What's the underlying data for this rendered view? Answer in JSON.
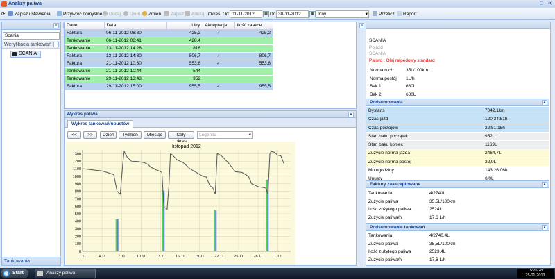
{
  "app": {
    "title": "Analizy paliwa",
    "maximize": "□",
    "close": "✕"
  },
  "toolbar": {
    "save_layout": "Zapisz ustawienia",
    "restore_default": "Przywróć domyślne",
    "add": "Dodaj",
    "delete": "Usuń",
    "edit": "Zmień",
    "save": "Zapisz",
    "cancel": "Anuluj",
    "period_label": "Okres",
    "from_label": "Od",
    "from_value": "01-11-2012",
    "to_label": "Do",
    "to_value": "30-11-2012",
    "period_select": "Inny",
    "recalc": "Przelicz",
    "report": "Raport"
  },
  "left": {
    "collapse": "«",
    "search_value": "Scania",
    "section": "Weryfikacja tankowań",
    "tree_item": "SCANIA",
    "bottom_tab": "Tankowania",
    "expand": "»"
  },
  "grid": {
    "headers": [
      "Dane",
      "Data",
      "Litry",
      "Akceptacja",
      "Ilość zaakce..."
    ],
    "rows": [
      {
        "type": "Faktura",
        "date": "06-11-2012 08:30",
        "litres": "425,2",
        "accepted": "✓",
        "accepted_qty": "425,2",
        "kind": "f"
      },
      {
        "type": "Tankowanie",
        "date": "06-11-2012 08:41",
        "litres": "428,4",
        "accepted": "",
        "accepted_qty": "",
        "kind": "t"
      },
      {
        "type": "Tankowanie",
        "date": "13-11-2012 14:28",
        "litres": "816",
        "accepted": "",
        "accepted_qty": "",
        "kind": "t"
      },
      {
        "type": "Faktura",
        "date": "13-11-2012 14:30",
        "litres": "806,7",
        "accepted": "✓",
        "accepted_qty": "806,7",
        "kind": "f"
      },
      {
        "type": "Faktura",
        "date": "21-11-2012 10:30",
        "litres": "553,6",
        "accepted": "✓",
        "accepted_qty": "553,6",
        "kind": "f"
      },
      {
        "type": "Tankowanie",
        "date": "21-11-2012 10:44",
        "litres": "544",
        "accepted": "",
        "accepted_qty": "",
        "kind": "t"
      },
      {
        "type": "Tankowanie",
        "date": "29-11-2012 13:43",
        "litres": "952",
        "accepted": "",
        "accepted_qty": "",
        "kind": "t"
      },
      {
        "type": "Faktura",
        "date": "29-11-2012 15:00",
        "litres": "955,5",
        "accepted": "✓",
        "accepted_qty": "955,5",
        "kind": "f"
      }
    ]
  },
  "chart_panel": {
    "title": "Wykres paliwa",
    "tab": "Wykres tankowań/upustów",
    "buttons": [
      "<<",
      ">>",
      "Dzień",
      "Tydzień",
      "Miesiąc",
      "Cały okres"
    ],
    "legend_placeholder": "Legenda"
  },
  "chart_data": {
    "type": "line",
    "title": "listopad 2012",
    "xlabel": "",
    "ylabel": "",
    "x_ticks": [
      "1.11",
      "4.11",
      "7.11",
      "10.11",
      "13.11",
      "16.11",
      "19.11",
      "22.11",
      "25.11",
      "28.11",
      "1.12"
    ],
    "y_ticks": [
      0,
      100,
      200,
      300,
      400,
      500,
      600,
      700,
      800,
      900,
      1000,
      1100,
      1200,
      1300
    ],
    "ylim": [
      0,
      1350
    ],
    "xlim": [
      1,
      33
    ],
    "grid": true,
    "series": [
      {
        "type": "line",
        "color": "#555555",
        "points": [
          [
            1,
            1100
          ],
          [
            1.5,
            1095
          ],
          [
            2,
            1090
          ],
          [
            3,
            1080
          ],
          [
            4,
            1070
          ],
          [
            5,
            1045
          ],
          [
            5.8,
            1020
          ],
          [
            6.3,
            800
          ],
          [
            6.8,
            760
          ],
          [
            7.2,
            1180
          ],
          [
            7.4,
            1330
          ],
          [
            7.8,
            1260
          ],
          [
            8.5,
            1200
          ],
          [
            9.5,
            1195
          ],
          [
            10.5,
            1180
          ],
          [
            11,
            1160
          ],
          [
            11.5,
            1120
          ],
          [
            12,
            1100
          ],
          [
            12.3,
            1085
          ],
          [
            12.8,
            1070
          ],
          [
            13.2,
            1050
          ],
          [
            13.5,
            590
          ],
          [
            14,
            560
          ],
          [
            14.3,
            900
          ],
          [
            14.5,
            1295
          ],
          [
            14.8,
            1285
          ],
          [
            15.5,
            1220
          ],
          [
            16.5,
            1180
          ],
          [
            17.5,
            1100
          ],
          [
            18.5,
            1050
          ],
          [
            19.5,
            1000
          ],
          [
            20,
            990
          ],
          [
            20.6,
            870
          ],
          [
            21,
            850
          ],
          [
            21.4,
            760
          ],
          [
            21.7,
            1300
          ],
          [
            22,
            1290
          ],
          [
            22.5,
            1260
          ],
          [
            23.5,
            1170
          ],
          [
            24.5,
            1060
          ],
          [
            25.5,
            1050
          ],
          [
            26.5,
            1000
          ],
          [
            27,
            900
          ],
          [
            27.5,
            880
          ],
          [
            28,
            860
          ],
          [
            28.8,
            850
          ],
          [
            29.2,
            840
          ],
          [
            29.5,
            760
          ],
          [
            29.8,
            1300
          ],
          [
            30,
            1330
          ],
          [
            30.5,
            1320
          ],
          [
            31,
            1280
          ],
          [
            31.5,
            1270
          ],
          [
            32,
            1160
          ]
        ]
      }
    ],
    "bars": [
      {
        "x": 6.3,
        "values": [
          425.2,
          428.4
        ],
        "colors": [
          "#55d055",
          "#5a7fe0"
        ]
      },
      {
        "x": 13.4,
        "values": [
          816,
          806.7
        ],
        "colors": [
          "#55d055",
          "#5a7fe0"
        ]
      },
      {
        "x": 21.4,
        "values": [
          553.6,
          544
        ],
        "colors": [
          "#55d055",
          "#5a7fe0"
        ]
      },
      {
        "x": 29.4,
        "values": [
          952,
          955.5
        ],
        "colors": [
          "#55d055",
          "#5a7fe0"
        ]
      }
    ]
  },
  "right": {
    "vehicle_name": "SCANIA",
    "vehicle_label": "Pojazd",
    "vehicle_value": "SCANIA",
    "fuel_line": "Paliwo : Olej napędowy standard",
    "norms": [
      {
        "label": "Norma ruch",
        "value": "35L/100km"
      },
      {
        "label": "Norma postój",
        "value": "1L/h"
      },
      {
        "label": "Bak 1",
        "value": "680L"
      },
      {
        "label": "Bak 2",
        "value": "680L"
      }
    ],
    "summary_title": "Podsumowania",
    "summary": [
      {
        "label": "Dystans",
        "value": "7042,1km",
        "c": "b"
      },
      {
        "label": "Czas jazd",
        "value": "120:34:51h",
        "c": "b"
      },
      {
        "label": "Czas postojów",
        "value": "22:51:15h",
        "c": "b"
      },
      {
        "label": "Stan baku początek",
        "value": "952L",
        "c": "g"
      },
      {
        "label": "Stan baku koniec",
        "value": "1169L",
        "c": "g"
      },
      {
        "label": "Zużycie norma jazda",
        "value": "2464,7L",
        "c": "y"
      },
      {
        "label": "Zużycie norma postój",
        "value": "22,9L",
        "c": "y"
      },
      {
        "label": "Motogodziny",
        "value": "143:26:06h",
        "c": "w"
      },
      {
        "label": "Upusty",
        "value": "0/0L",
        "c": "w"
      }
    ],
    "invoices_title": "Faktury zaakceptowane",
    "invoices": [
      {
        "label": "Tankowania",
        "value": "4/2741L"
      },
      {
        "label": "Zużycie paliwa",
        "value": "35,5L/100km"
      },
      {
        "label": "Ilość zużytego paliwa",
        "value": "2524L"
      },
      {
        "label": "Zużycie paliwa/h",
        "value": "17,6 L/h"
      }
    ],
    "refuel_title": "Podsumowanie tankowań",
    "refuel": [
      {
        "label": "Tankowania",
        "value": "4/2740,4L"
      },
      {
        "label": "Zużycie paliwa",
        "value": "35,5L/100km"
      },
      {
        "label": "Ilość zużytego paliwa",
        "value": "2523,4L"
      },
      {
        "label": "Zużycie paliwa/h",
        "value": "17,6 L/h"
      }
    ],
    "collapse": "»",
    "section_toggle": "▲"
  },
  "taskbar": {
    "start": "Start",
    "app": "Analizy paliwa",
    "time": "15:26:28",
    "date": "25-01-2013"
  },
  "colors": {
    "faktura_row": "#b9d2ef",
    "tankowanie_row": "#a0f0a9",
    "accent": "#15428b",
    "plot_bg": "#fbf8dc"
  }
}
